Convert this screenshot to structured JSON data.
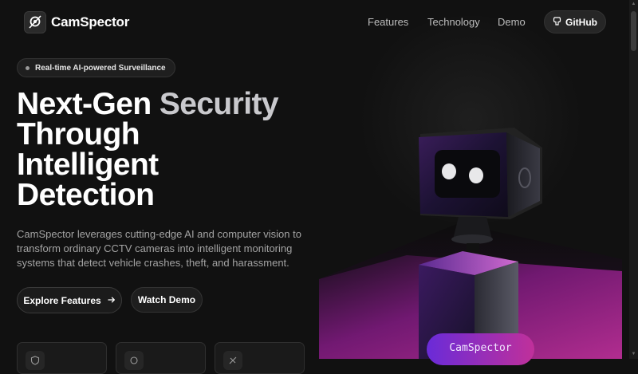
{
  "header": {
    "logo_text": "CamSpector",
    "logo_icon": "camera-eye-icon",
    "nav": [
      "Features",
      "Technology",
      "Demo"
    ],
    "github_label": "GitHub"
  },
  "hero": {
    "badge": "Real-time AI-powered Surveillance",
    "headline": {
      "word1": "Next-Gen",
      "word2": "Security",
      "line2": "Through",
      "line3": "Intelligent",
      "line4": "Detection"
    },
    "description": "CamSpector leverages cutting-edge AI and computer vision to transform ordinary CCTV cameras into intelligent monitoring systems that detect vehicle crashes, theft, and harassment.",
    "primary_button": "Explore Features",
    "secondary_button": "Watch Demo"
  },
  "visual": {
    "pill_label": "CamSpector"
  },
  "colors": {
    "background": "#111111",
    "accent_purple": "#6a2bd8",
    "accent_magenta": "#c0309a"
  }
}
